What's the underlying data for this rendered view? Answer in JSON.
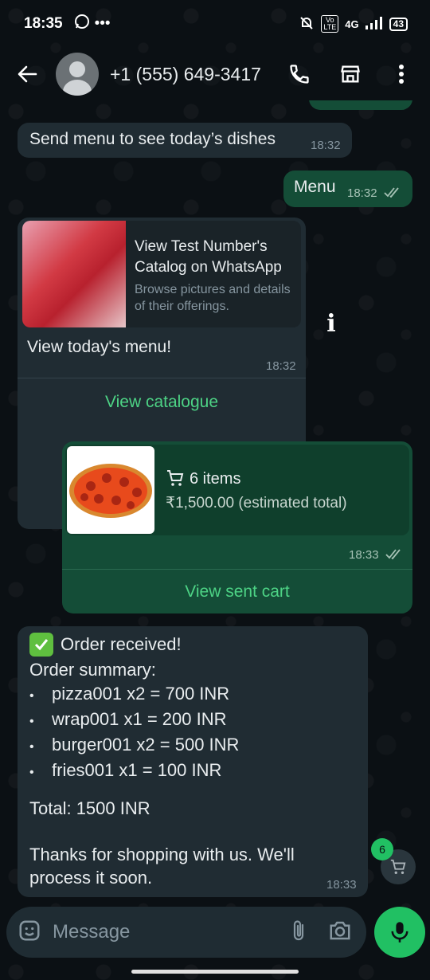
{
  "status_bar": {
    "time": "18:35",
    "network": "4G",
    "volte": "Vo LTE",
    "battery": "43"
  },
  "header": {
    "contact": "+1 (555) 649-3417"
  },
  "messages": {
    "m1": {
      "text": "Send menu to see today’s dishes",
      "time": "18:32"
    },
    "m2": {
      "text": "Menu",
      "time": "18:32"
    },
    "m3": {
      "link_title": "View Test Number's Catalog on WhatsApp",
      "link_desc": "Browse pictures and details of their offerings.",
      "text": "View today's menu!",
      "time": "18:32",
      "action": "View catalogue"
    },
    "m4": {
      "items": "6 items",
      "total": "₹1,500.00 (estimated total)",
      "time": "18:33",
      "action": "View sent cart"
    },
    "m5": {
      "heading": "Order received!",
      "summary": "Order summary:",
      "lines": [
        "pizza001 x2 = 700 INR",
        "wrap001 x1 = 200 INR",
        "burger001 x2 = 500 INR",
        "fries001 x1 = 100 INR"
      ],
      "total": "Total: 1500 INR",
      "thanks_1": "Thanks for shopping with us. We'll",
      "thanks_2": "process it soon.",
      "time": "18:33"
    }
  },
  "cart_fab": {
    "count": "6"
  },
  "composer": {
    "placeholder": "Message"
  },
  "colors": {
    "incoming": "#202c33",
    "outgoing": "#144d37",
    "accent": "#21c063",
    "link": "#4dd385"
  }
}
